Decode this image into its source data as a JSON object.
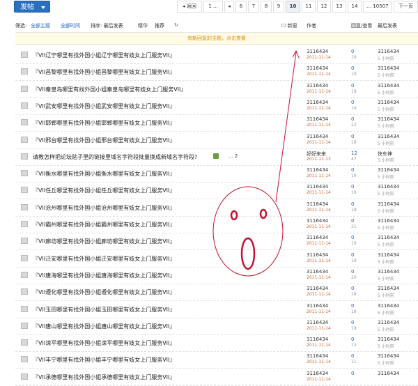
{
  "toolbar": {
    "post_label": "发帖"
  },
  "pager": {
    "prev": "◂ 返回",
    "pages": [
      "1 ...",
      "◂",
      "6",
      "7",
      "8",
      "9",
      "10",
      "11",
      "12",
      "13",
      "14",
      "... 10507"
    ],
    "current": "10",
    "next": "下一页"
  },
  "filter": {
    "label": "筛选:",
    "all_topics": "全部主题",
    "all_time": "全部时间",
    "sort": "排序: 最后发表",
    "digest": "精华",
    "recommend": "推荐",
    "new_window": "新窗"
  },
  "columns": {
    "author": "作者",
    "reply_view": "回复/查看",
    "last_post": "最后发表"
  },
  "notice": "有新回复的主题，点击查看",
  "rows": [
    {
      "title": "『VII辽宁哪里有找外国小姐辽宁哪里有妓女上门服务VII』",
      "author": "3116434",
      "date": "2011-11-14",
      "replies": "0",
      "views": "19",
      "last_user": "3116434",
      "last_time": "5 小时前"
    },
    {
      "title": "『VII昌黎哪里有找外国小姐昌黎哪里有妓女上门服务VII』",
      "author": "3116434",
      "date": "2011-11-14",
      "replies": "0",
      "views": "19",
      "last_user": "3116434",
      "last_time": "5 小时前"
    },
    {
      "title": "『VII秦皇岛哪里有找外国小姐秦皇岛哪里有妓女上门服务VII』",
      "author": "3116434",
      "date": "2011-11-14",
      "replies": "0",
      "views": "18",
      "last_user": "3116434",
      "last_time": "5 小时前"
    },
    {
      "title": "『VII武安哪里有找外国小姐武安哪里有妓女上门服务VII』",
      "author": "3116434",
      "date": "2011-11-14",
      "replies": "0",
      "views": "19",
      "last_user": "3116434",
      "last_time": "5 小时前"
    },
    {
      "title": "『VII邯郸哪里有找外国小姐邯郸哪里有妓女上门服务VII』",
      "author": "3116434",
      "date": "2011-11-14",
      "replies": "0",
      "views": "22",
      "last_user": "3116434",
      "last_time": "5 小时前"
    },
    {
      "title": "『VII邢台哪里有找外国小姐邢台哪里有妓女上门服务VII』",
      "author": "3116434",
      "date": "2011-11-14",
      "replies": "0",
      "views": "18",
      "last_user": "3116434",
      "last_time": "5 小时前"
    },
    {
      "title": "请教怎样把论坛贴子里的链接里域名字符段批量换成新域名字符段?",
      "author": "好好来来",
      "date": "2011-11-13",
      "replies": "12",
      "views": "47",
      "last_user": "快车神",
      "last_time": "5 小时前",
      "ext": "... 2",
      "thumb": true
    },
    {
      "title": "『VII衡水哪里有找外国小姐衡水哪里有妓女上门服务VII』",
      "author": "3116434",
      "date": "2011-11-14",
      "replies": "0",
      "views": "19",
      "last_user": "3116434",
      "last_time": "5 小时前"
    },
    {
      "title": "『VII任丘哪里有找外国小姐任丘哪里有妓女上门服务VII』",
      "author": "3116434",
      "date": "2011-11-14",
      "replies": "0",
      "views": "19",
      "last_user": "3116434",
      "last_time": "5 小时前"
    },
    {
      "title": "『VII沧州哪里有找外国小姐沧州哪里有妓女上门服务VII』",
      "author": "3116434",
      "date": "2011-11-14",
      "replies": "0",
      "views": "18",
      "last_user": "3116434",
      "last_time": "5 小时前"
    },
    {
      "title": "『VII霸州哪里有找外国小姐霸州哪里有妓女上门服务VII』",
      "author": "3116434",
      "date": "2011-11-14",
      "replies": "0",
      "views": "21",
      "last_user": "3116434",
      "last_time": "5 小时前"
    },
    {
      "title": "『VII廊坊哪里有找外国小姐廊坊哪里有妓女上门服务VII』",
      "author": "3116434",
      "date": "2011-11-14",
      "replies": "0",
      "views": "16",
      "last_user": "3116434",
      "last_time": "5 小时前"
    },
    {
      "title": "『VII迁安哪里有找外国小姐迁安哪里有妓女上门服务VII』",
      "author": "3116434",
      "date": "2011-11-14",
      "replies": "0",
      "views": "19",
      "last_user": "3116434",
      "last_time": "5 小时前"
    },
    {
      "title": "『VII唐海哪里有找外国小姐唐海哪里有妓女上门服务VII』",
      "author": "3116434",
      "date": "2011-11-14",
      "replies": "0",
      "views": "20",
      "last_user": "3116434",
      "last_time": "5 小时前"
    },
    {
      "title": "『VII遵化哪里有找外国小姐遵化哪里有妓女上门服务VII』",
      "author": "3116434",
      "date": "2011-11-14",
      "replies": "0",
      "views": "18",
      "last_user": "3116434",
      "last_time": "5 小时前"
    },
    {
      "title": "『VII玉田哪里有找外国小姐玉田哪里有妓女上门服务VII』",
      "author": "3116434",
      "date": "2011-11-14",
      "replies": "0",
      "views": "19",
      "last_user": "3116434",
      "last_time": "5 小时前"
    },
    {
      "title": "『VII唐山哪里有找外国小姐唐山哪里有妓女上门服务VII』",
      "author": "3116434",
      "date": "2011-11-14",
      "replies": "0",
      "views": "19",
      "last_user": "3116434",
      "last_time": "5 小时前"
    },
    {
      "title": "『VII滦平哪里有找外国小姐滦平哪里有妓女上门服务VII』",
      "author": "3116434",
      "date": "2011-11-14",
      "replies": "0",
      "views": "13",
      "last_user": "3116434",
      "last_time": "5 小时前"
    },
    {
      "title": "『VII丰宁哪里有找外国小姐丰宁哪里有妓女上门服务VII』",
      "author": "3116434",
      "date": "2011-11-14",
      "replies": "0",
      "views": "11",
      "last_user": "3116434",
      "last_time": "5 小时前"
    },
    {
      "title": "『VII承德哪里有找外国小姐承德哪里有妓女上门服务VII』",
      "author": "3116434",
      "date": "2011-11-14",
      "replies": "0",
      "views": "",
      "last_user": "3116434",
      "last_time": ""
    }
  ],
  "colors": {
    "accent": "#2b6fc0",
    "link": "#2862b5",
    "annotation": "#c8102e",
    "date": "#d0652e"
  }
}
